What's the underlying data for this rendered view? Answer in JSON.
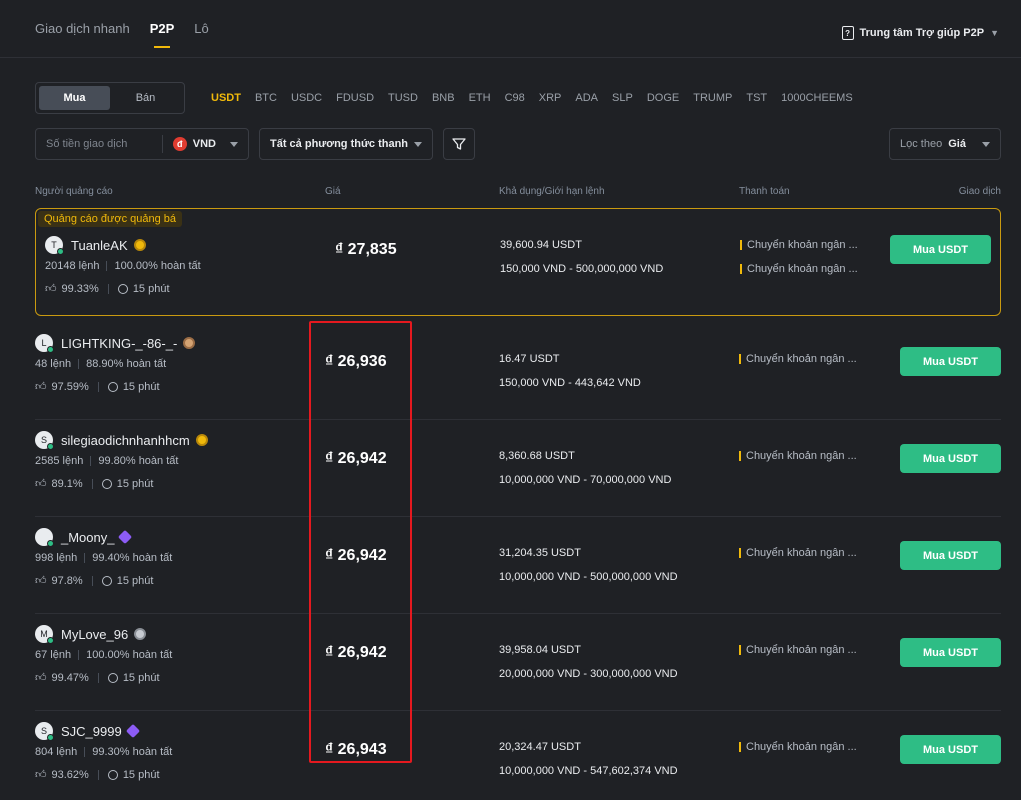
{
  "nav": {
    "tabs": [
      "Giao dịch nhanh",
      "P2P",
      "Lô"
    ],
    "active_tab": 1,
    "help": "Trung tâm Trợ giúp P2P"
  },
  "trade": {
    "buy": "Mua",
    "sell": "Bán",
    "coins": [
      "USDT",
      "BTC",
      "USDC",
      "FDUSD",
      "TUSD",
      "BNB",
      "ETH",
      "C98",
      "XRP",
      "ADA",
      "SLP",
      "DOGE",
      "TRUMP",
      "TST",
      "1000CHEEMS"
    ],
    "active_coin": 0
  },
  "filters": {
    "amount_placeholder": "Số tiền giao dịch",
    "currency": "VND",
    "currency_symbol": "đ",
    "payment_methods": "Tất cả phương thức thanh",
    "sort_label": "Lọc theo",
    "sort_value": "Giá"
  },
  "table": {
    "headers": {
      "advertiser": "Người quảng cáo",
      "price": "Giá",
      "available": "Khả dụng/Giới hạn lệnh",
      "payment": "Thanh toán",
      "trade": "Giao dịch"
    },
    "promoted_label": "Quảng cáo được quảng bá",
    "listings": [
      {
        "initial": "T",
        "name": "TuanleAK",
        "badge": "gold",
        "orders": "20148 lệnh",
        "completion": "100.00% hoàn tất",
        "rating": "99.33%",
        "time": "15 phút",
        "price": "₫ 27,835",
        "available": "39,600.94 USDT",
        "limit": "150,000 VND - 500,000,000 VND",
        "payments": [
          "Chuyển khoản ngân ...",
          "Chuyển khoản ngân ..."
        ],
        "button": "Mua USDT"
      },
      {
        "initial": "L",
        "name": "LIGHTKING-_-86-_-",
        "badge": "bronze",
        "orders": "48 lệnh",
        "completion": "88.90% hoàn tất",
        "rating": "97.59%",
        "time": "15 phút",
        "price": "₫ 26,936",
        "available": "16.47 USDT",
        "limit": "150,000 VND - 443,642 VND",
        "payments": [
          "Chuyển khoản ngân ..."
        ],
        "button": "Mua USDT"
      },
      {
        "initial": "S",
        "name": "silegiaodichnhanhhcm",
        "badge": "gold",
        "orders": "2585 lệnh",
        "completion": "99.80% hoàn tất",
        "rating": "89.1%",
        "time": "15 phút",
        "price": "₫ 26,942",
        "available": "8,360.68 USDT",
        "limit": "10,000,000 VND - 70,000,000 VND",
        "payments": [
          "Chuyển khoản ngân ..."
        ],
        "button": "Mua USDT"
      },
      {
        "initial": "",
        "name": "_Moony_",
        "badge": "purple",
        "orders": "998 lệnh",
        "completion": "99.40% hoàn tất",
        "rating": "97.8%",
        "time": "15 phút",
        "price": "₫ 26,942",
        "available": "31,204.35 USDT",
        "limit": "10,000,000 VND - 500,000,000 VND",
        "payments": [
          "Chuyển khoản ngân ..."
        ],
        "button": "Mua USDT"
      },
      {
        "initial": "M",
        "name": "MyLove_96",
        "badge": "gray",
        "orders": "67 lệnh",
        "completion": "100.00% hoàn tất",
        "rating": "99.47%",
        "time": "15 phút",
        "price": "₫ 26,942",
        "available": "39,958.04 USDT",
        "limit": "20,000,000 VND - 300,000,000 VND",
        "payments": [
          "Chuyển khoản ngân ..."
        ],
        "button": "Mua USDT"
      },
      {
        "initial": "S",
        "name": "SJC_9999",
        "badge": "purple",
        "orders": "804 lệnh",
        "completion": "99.30% hoàn tất",
        "rating": "93.62%",
        "time": "15 phút",
        "price": "₫ 26,943",
        "available": "20,324.47 USDT",
        "limit": "10,000,000 VND - 547,602,374 VND",
        "payments": [
          "Chuyển khoản ngân ..."
        ],
        "button": "Mua USDT"
      }
    ]
  },
  "colors": {
    "accent": "#f0b90b",
    "buy": "#2ebd85",
    "highlight": "#e5191f",
    "background": "#1f2125"
  }
}
